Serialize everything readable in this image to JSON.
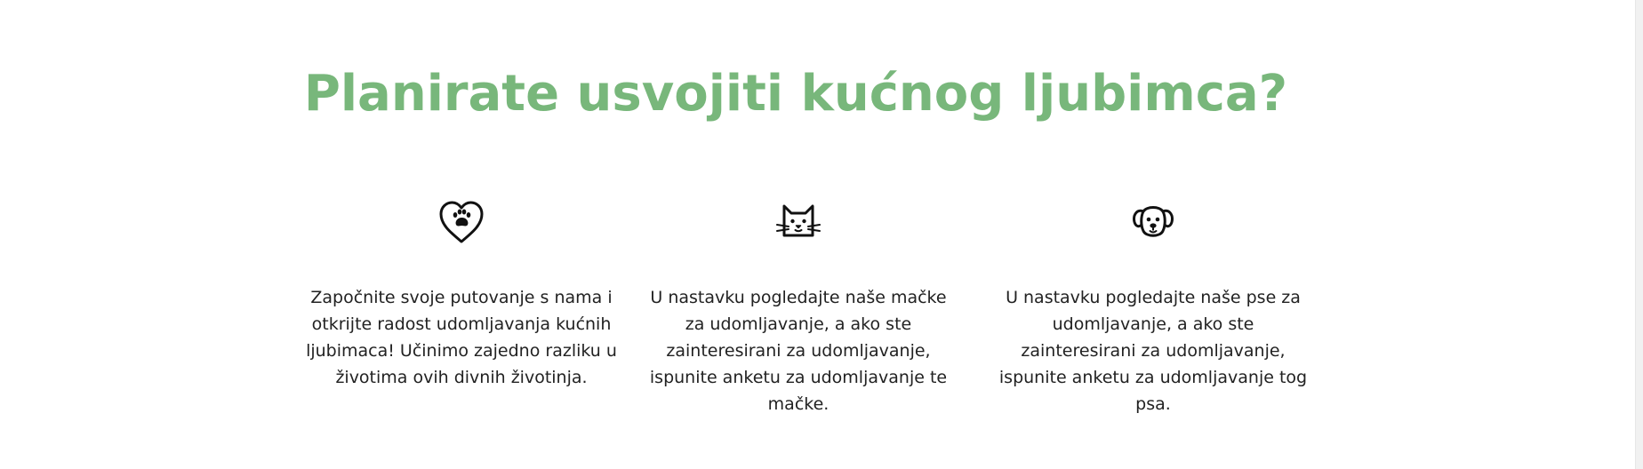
{
  "section": {
    "title": "Planirate usvojiti kućnog ljubimca?",
    "title_color": "#78b77b"
  },
  "features": [
    {
      "icon": "heart-paw-icon",
      "text": "Započnite svoje putovanje s nama i otkrijte radost udomljavanja kućnih ljubimaca! Učinimo zajedno razliku u životima ovih divnih životinja."
    },
    {
      "icon": "cat-face-icon",
      "text": "U nastavku pogledajte naše mačke za udomljavanje, a ako ste zainteresirani za udomljavanje, ispunite anketu za udomljavanje te mačke."
    },
    {
      "icon": "dog-face-icon",
      "text": "U nastavku pogledajte naše pse za udomljavanje, a ako ste zainteresirani za udomljavanje, ispunite anketu za udomljavanje tog psa."
    }
  ]
}
